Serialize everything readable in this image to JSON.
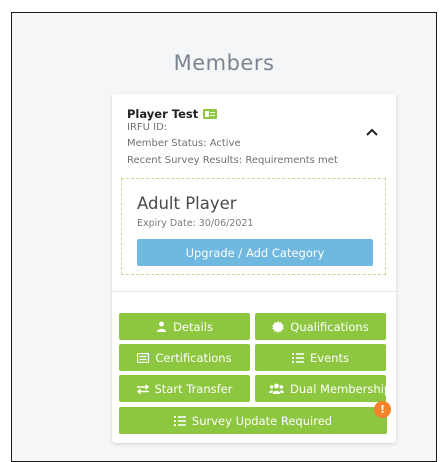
{
  "page": {
    "title": "Members"
  },
  "member": {
    "name": "Player Test",
    "irfu_id": "IRFU ID:",
    "status": "Member Status: Active",
    "survey_results": "Recent Survey Results: Requirements met"
  },
  "category": {
    "title": "Adult Player",
    "expiry": "Expiry Date: 30/06/2021",
    "upgrade_label": "Upgrade / Add Category"
  },
  "actions": {
    "details": "Details",
    "qualifications": "Qualifications",
    "certifications": "Certifications",
    "events": "Events",
    "start_transfer": "Start Transfer",
    "dual_membership": "Dual Membership",
    "survey_update": "Survey Update Required"
  },
  "badges": {
    "warning": "!"
  },
  "colors": {
    "accent_green": "#8dc63f",
    "accent_blue": "#6fb8df",
    "warning_orange": "#f5822a",
    "title_gray": "#7a8591"
  },
  "icons": {
    "member": "id-card-icon",
    "collapse": "chevron-up-icon",
    "details": "user-icon",
    "qualifications": "badge-icon",
    "certifications": "certificate-icon",
    "events": "list-icon",
    "start_transfer": "transfer-icon",
    "dual_membership": "users-icon",
    "survey_update": "list-icon",
    "warning": "exclamation-icon"
  }
}
